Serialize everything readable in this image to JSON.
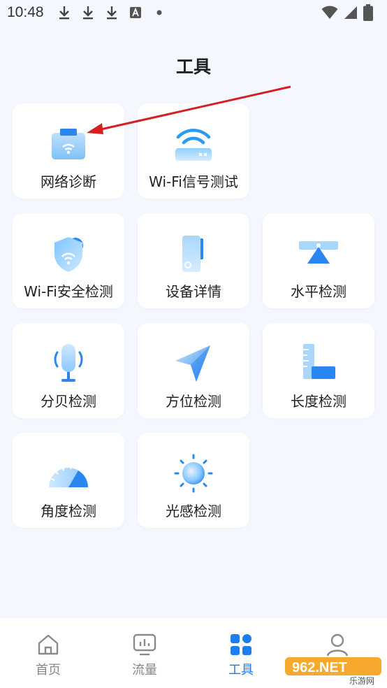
{
  "status_bar": {
    "time": "10:48",
    "icons_left": [
      "download-icon",
      "download-icon",
      "download-icon",
      "a-box-icon",
      "dot-icon"
    ],
    "icons_right": [
      "wifi-icon",
      "signal-icon",
      "battery-icon"
    ]
  },
  "header": {
    "title": "工具"
  },
  "tools": [
    {
      "label": "网络诊断",
      "icon": "network-diagnosis-icon"
    },
    {
      "label": "Wi-Fi信号测试",
      "icon": "wifi-signal-icon"
    },
    {
      "label": "Wi-Fi安全检测",
      "icon": "wifi-shield-icon"
    },
    {
      "label": "设备详情",
      "icon": "device-icon"
    },
    {
      "label": "水平检测",
      "icon": "level-icon"
    },
    {
      "label": "分贝检测",
      "icon": "microphone-icon"
    },
    {
      "label": "方位检测",
      "icon": "compass-arrow-icon"
    },
    {
      "label": "长度检测",
      "icon": "ruler-icon"
    },
    {
      "label": "角度检测",
      "icon": "protractor-icon"
    },
    {
      "label": "光感检测",
      "icon": "light-sun-icon"
    }
  ],
  "bottom_nav": [
    {
      "label": "首页",
      "icon": "home-icon",
      "active": false
    },
    {
      "label": "流量",
      "icon": "traffic-chart-icon",
      "active": false
    },
    {
      "label": "工具",
      "icon": "tools-grid-icon",
      "active": true
    },
    {
      "label": "",
      "icon": "person-icon",
      "active": false
    }
  ],
  "watermark": {
    "text": "962.NET",
    "subtext": "乐游网"
  },
  "colors": {
    "accent": "#1e7ef0",
    "background": "#f4f7fd",
    "annotation": "#d42020"
  }
}
